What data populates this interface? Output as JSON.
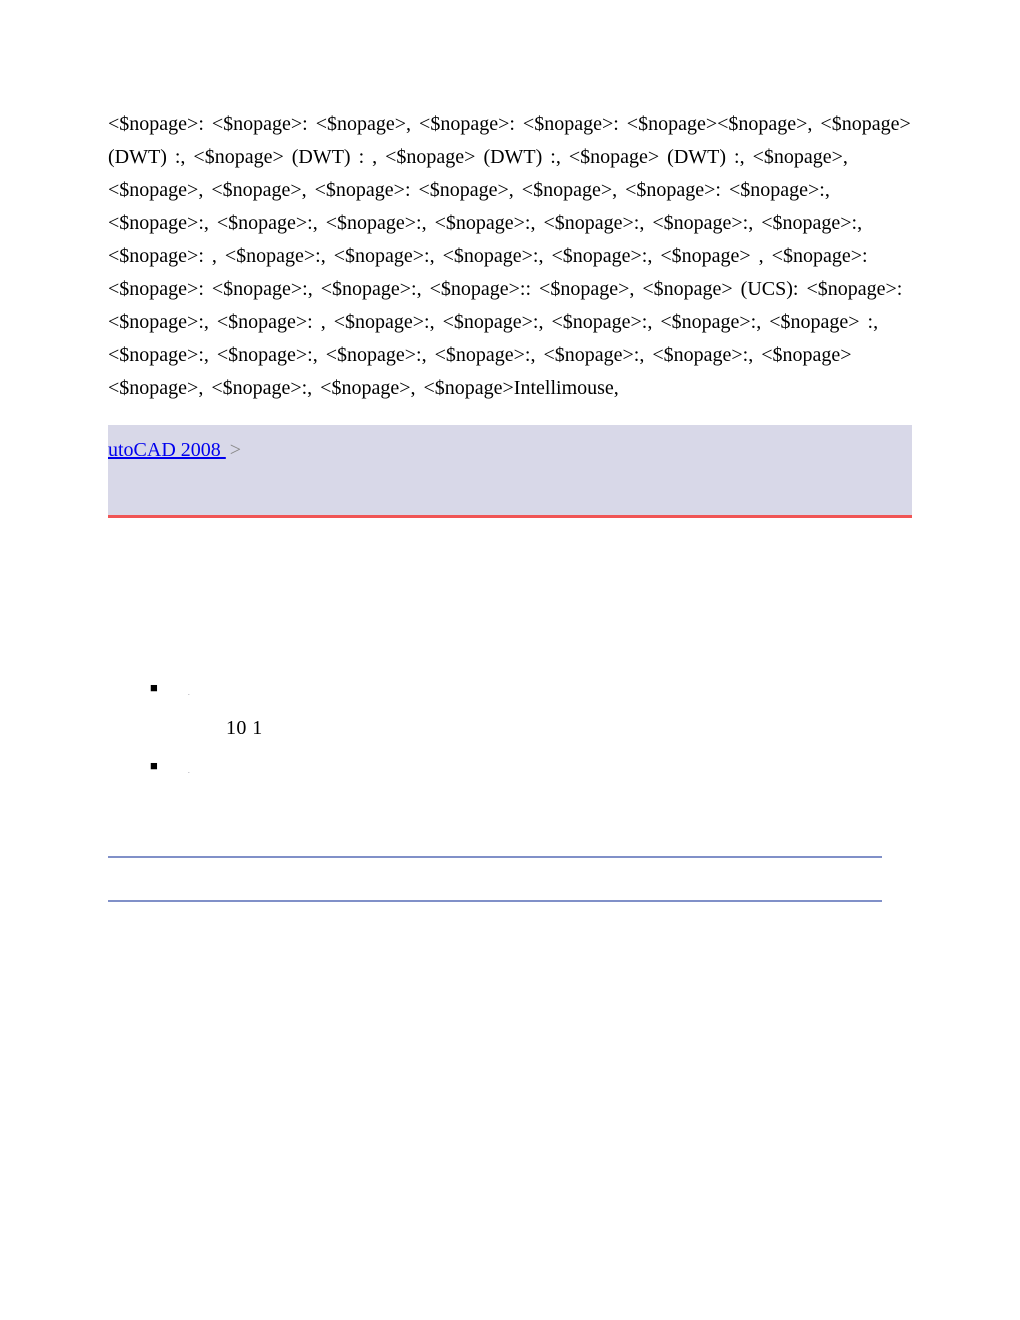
{
  "nopage_text": "<$nopage>:   <$nopage>:   <$nopage>,   <$nopage>:           <$nopage>:   <$nopage><$nopage>,    <$nopage> (DWT) :,          <$nopage> (DWT) :          ,    <$nopage> (DWT) :,          <$nopage> (DWT) :,          <$nopage>,   <$nopage>,   <$nopage>,   <$nopage>:            <$nopage>,   <$nopage>,   <$nopage>:   <$nopage>:,      <$nopage>:,      <$nopage>:,       <$nopage>:,      <$nopage>:,      <$nopage>:,      <$nopage>:,      <$nopage>:,      <$nopage>:      ,   <$nopage>:,      <$nopage>:,      <$nopage>:,      <$nopage>:,      <$nopage>      ,   <$nopage>:   <$nopage>:   <$nopage>:,      <$nopage>:,      <$nopage>::   <$nopage>,    <$nopage> (UCS):   <$nopage>:   <$nopage>:,      <$nopage>:      ,   <$nopage>:,      <$nopage>:,      <$nopage>:,      <$nopage>:,      <$nopage>      :,             <$nopage>:,      <$nopage>:,      <$nopage>:,      <$nopage>:,      <$nopage>:,      <$nopage>:,       <$nopage><$nopage>,    <$nopage>:,      <$nopage>,    <$nopage>Intellimouse,",
  "breadcrumb": {
    "link_text": "utoCAD 2008 ",
    "separator": ">"
  },
  "list": {
    "item1_dot": ".",
    "numbers": "10   1",
    "item2_dot": "."
  }
}
